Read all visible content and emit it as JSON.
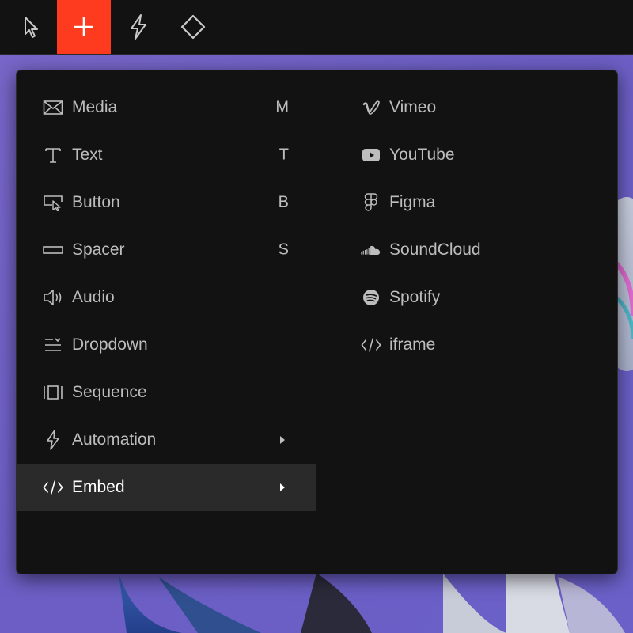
{
  "toolbar": {
    "tools": [
      {
        "icon": "pointer-icon",
        "active": false
      },
      {
        "icon": "plus-icon",
        "active": true
      },
      {
        "icon": "lightning-icon",
        "active": false
      },
      {
        "icon": "diamond-icon",
        "active": false
      }
    ],
    "accent": "#ff3b1f"
  },
  "menu": {
    "left_items": [
      {
        "label": "Media",
        "shortcut": "M",
        "icon": "media-icon"
      },
      {
        "label": "Text",
        "shortcut": "T",
        "icon": "text-icon"
      },
      {
        "label": "Button",
        "shortcut": "B",
        "icon": "button-icon"
      },
      {
        "label": "Spacer",
        "shortcut": "S",
        "icon": "spacer-icon"
      },
      {
        "label": "Audio",
        "shortcut": "",
        "icon": "audio-icon"
      },
      {
        "label": "Dropdown",
        "shortcut": "",
        "icon": "dropdown-icon"
      },
      {
        "label": "Sequence",
        "shortcut": "",
        "icon": "sequence-icon"
      },
      {
        "label": "Automation",
        "shortcut": "",
        "icon": "lightning-icon",
        "submenu": true
      },
      {
        "label": "Embed",
        "shortcut": "",
        "icon": "code-icon",
        "submenu": true,
        "selected": true
      }
    ],
    "right_items": [
      {
        "label": "Vimeo",
        "icon": "vimeo-icon"
      },
      {
        "label": "YouTube",
        "icon": "youtube-icon"
      },
      {
        "label": "Figma",
        "icon": "figma-icon"
      },
      {
        "label": "SoundCloud",
        "icon": "soundcloud-icon"
      },
      {
        "label": "Spotify",
        "icon": "spotify-icon"
      },
      {
        "label": "iframe",
        "icon": "code-icon"
      }
    ]
  },
  "colors": {
    "menu_bg": "#121212",
    "selected_bg": "#2a2a2a",
    "text": "#bdbdbd",
    "canvas": "#6c5ec4"
  }
}
